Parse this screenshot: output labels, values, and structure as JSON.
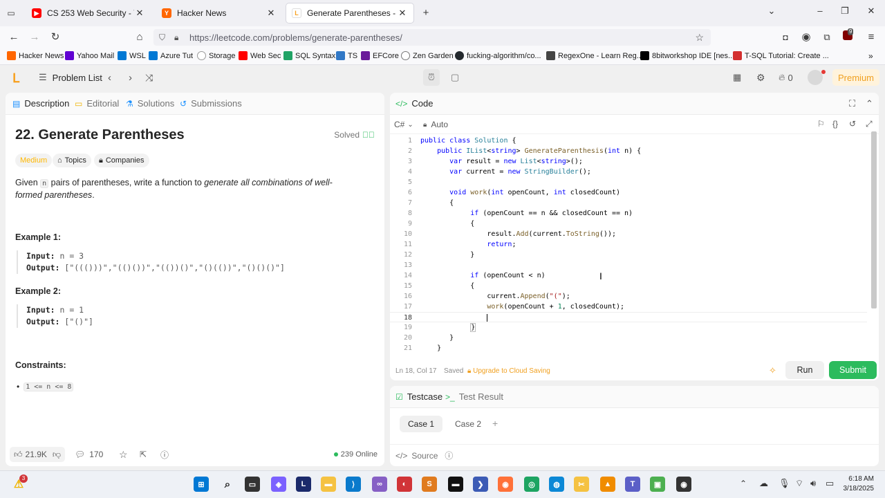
{
  "browser": {
    "tabs": [
      {
        "title": "CS 253 Web Security - YouTube",
        "icon": "youtube-icon"
      },
      {
        "title": "Hacker News",
        "icon": "hackernews-icon"
      },
      {
        "title": "Generate Parentheses - LeetCo",
        "icon": "leetcode-icon"
      }
    ],
    "url": "https://leetcode.com/problems/generate-parentheses/",
    "bookmarks": [
      "Hacker News",
      "Yahoo Mail",
      "WSL",
      "Azure Tut",
      "Storage",
      "Web Sec",
      "SQL Syntax",
      "TS",
      "EFCore",
      "Zen Garden",
      "fucking-algorithm/co...",
      "RegexOne - Learn Reg...",
      "8bitworkshop IDE [nes...",
      "T-SQL Tutorial: Create ..."
    ],
    "extension_badge": "9"
  },
  "header": {
    "problem_list": "Problem List",
    "streak_count": "0",
    "premium": "Premium"
  },
  "left": {
    "tabs": [
      "Description",
      "Editorial",
      "Solutions",
      "Submissions"
    ],
    "title": "22. Generate Parentheses",
    "status": "Solved",
    "difficulty": "Medium",
    "chips": [
      "Topics",
      "Companies"
    ],
    "desc_prefix": "Given ",
    "desc_code": "n",
    "desc_mid": " pairs of parentheses, write a function to ",
    "desc_em": "generate all combinations of well-formed parentheses",
    "desc_end": ".",
    "example1_h": "Example 1:",
    "example1_input_label": "Input:",
    "example1_input": "n = 3",
    "example1_output_label": "Output:",
    "example1_output": "[\"((()))\",\"(()())\",\"(())()\",\"()(())\",\"()()()\"]",
    "example2_h": "Example 2:",
    "example2_input_label": "Input:",
    "example2_input": "n = 1",
    "example2_output_label": "Output:",
    "example2_output": "[\"()\"]",
    "constraints_h": "Constraints:",
    "constraint1": "1 <= n <= 8",
    "likes": "21.9K",
    "comments": "170",
    "online": "239 Online"
  },
  "code": {
    "tab": "Code",
    "language": "C#",
    "mode": "Auto",
    "status_pos": "Ln 18, Col 17",
    "status_saved": "Saved",
    "status_upgrade": "Upgrade to Cloud Saving",
    "run": "Run",
    "submit": "Submit",
    "lines": [
      "1",
      "2",
      "3",
      "4",
      "5",
      "6",
      "7",
      "8",
      "9",
      "10",
      "11",
      "12",
      "13",
      "14",
      "15",
      "16",
      "17",
      "18",
      "19",
      "20",
      "21"
    ]
  },
  "test": {
    "tabs": [
      "Testcase",
      "Test Result"
    ],
    "cases": [
      "Case 1",
      "Case 2"
    ],
    "add": "+",
    "source": "Source"
  },
  "taskbar": {
    "notif_badge": "3",
    "time": "6:18 AM",
    "date": "3/18/2025"
  }
}
